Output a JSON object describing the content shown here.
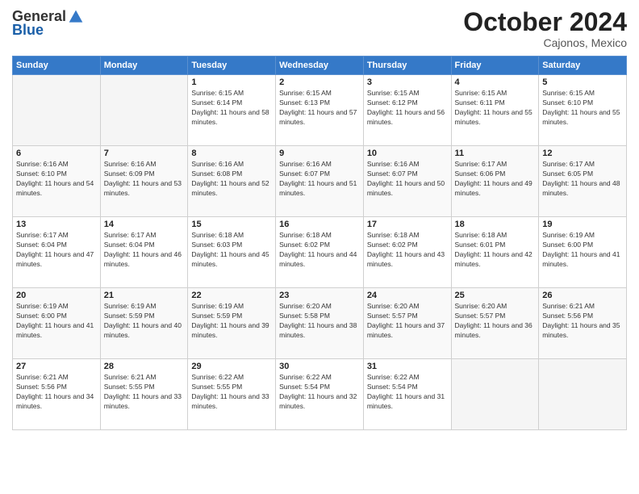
{
  "logo": {
    "general": "General",
    "blue": "Blue"
  },
  "header": {
    "month": "October 2024",
    "location": "Cajonos, Mexico"
  },
  "weekdays": [
    "Sunday",
    "Monday",
    "Tuesday",
    "Wednesday",
    "Thursday",
    "Friday",
    "Saturday"
  ],
  "weeks": [
    [
      {
        "day": "",
        "sunrise": "",
        "sunset": "",
        "daylight": ""
      },
      {
        "day": "",
        "sunrise": "",
        "sunset": "",
        "daylight": ""
      },
      {
        "day": "1",
        "sunrise": "Sunrise: 6:15 AM",
        "sunset": "Sunset: 6:14 PM",
        "daylight": "Daylight: 11 hours and 58 minutes."
      },
      {
        "day": "2",
        "sunrise": "Sunrise: 6:15 AM",
        "sunset": "Sunset: 6:13 PM",
        "daylight": "Daylight: 11 hours and 57 minutes."
      },
      {
        "day": "3",
        "sunrise": "Sunrise: 6:15 AM",
        "sunset": "Sunset: 6:12 PM",
        "daylight": "Daylight: 11 hours and 56 minutes."
      },
      {
        "day": "4",
        "sunrise": "Sunrise: 6:15 AM",
        "sunset": "Sunset: 6:11 PM",
        "daylight": "Daylight: 11 hours and 55 minutes."
      },
      {
        "day": "5",
        "sunrise": "Sunrise: 6:15 AM",
        "sunset": "Sunset: 6:10 PM",
        "daylight": "Daylight: 11 hours and 55 minutes."
      }
    ],
    [
      {
        "day": "6",
        "sunrise": "Sunrise: 6:16 AM",
        "sunset": "Sunset: 6:10 PM",
        "daylight": "Daylight: 11 hours and 54 minutes."
      },
      {
        "day": "7",
        "sunrise": "Sunrise: 6:16 AM",
        "sunset": "Sunset: 6:09 PM",
        "daylight": "Daylight: 11 hours and 53 minutes."
      },
      {
        "day": "8",
        "sunrise": "Sunrise: 6:16 AM",
        "sunset": "Sunset: 6:08 PM",
        "daylight": "Daylight: 11 hours and 52 minutes."
      },
      {
        "day": "9",
        "sunrise": "Sunrise: 6:16 AM",
        "sunset": "Sunset: 6:07 PM",
        "daylight": "Daylight: 11 hours and 51 minutes."
      },
      {
        "day": "10",
        "sunrise": "Sunrise: 6:16 AM",
        "sunset": "Sunset: 6:07 PM",
        "daylight": "Daylight: 11 hours and 50 minutes."
      },
      {
        "day": "11",
        "sunrise": "Sunrise: 6:17 AM",
        "sunset": "Sunset: 6:06 PM",
        "daylight": "Daylight: 11 hours and 49 minutes."
      },
      {
        "day": "12",
        "sunrise": "Sunrise: 6:17 AM",
        "sunset": "Sunset: 6:05 PM",
        "daylight": "Daylight: 11 hours and 48 minutes."
      }
    ],
    [
      {
        "day": "13",
        "sunrise": "Sunrise: 6:17 AM",
        "sunset": "Sunset: 6:04 PM",
        "daylight": "Daylight: 11 hours and 47 minutes."
      },
      {
        "day": "14",
        "sunrise": "Sunrise: 6:17 AM",
        "sunset": "Sunset: 6:04 PM",
        "daylight": "Daylight: 11 hours and 46 minutes."
      },
      {
        "day": "15",
        "sunrise": "Sunrise: 6:18 AM",
        "sunset": "Sunset: 6:03 PM",
        "daylight": "Daylight: 11 hours and 45 minutes."
      },
      {
        "day": "16",
        "sunrise": "Sunrise: 6:18 AM",
        "sunset": "Sunset: 6:02 PM",
        "daylight": "Daylight: 11 hours and 44 minutes."
      },
      {
        "day": "17",
        "sunrise": "Sunrise: 6:18 AM",
        "sunset": "Sunset: 6:02 PM",
        "daylight": "Daylight: 11 hours and 43 minutes."
      },
      {
        "day": "18",
        "sunrise": "Sunrise: 6:18 AM",
        "sunset": "Sunset: 6:01 PM",
        "daylight": "Daylight: 11 hours and 42 minutes."
      },
      {
        "day": "19",
        "sunrise": "Sunrise: 6:19 AM",
        "sunset": "Sunset: 6:00 PM",
        "daylight": "Daylight: 11 hours and 41 minutes."
      }
    ],
    [
      {
        "day": "20",
        "sunrise": "Sunrise: 6:19 AM",
        "sunset": "Sunset: 6:00 PM",
        "daylight": "Daylight: 11 hours and 41 minutes."
      },
      {
        "day": "21",
        "sunrise": "Sunrise: 6:19 AM",
        "sunset": "Sunset: 5:59 PM",
        "daylight": "Daylight: 11 hours and 40 minutes."
      },
      {
        "day": "22",
        "sunrise": "Sunrise: 6:19 AM",
        "sunset": "Sunset: 5:59 PM",
        "daylight": "Daylight: 11 hours and 39 minutes."
      },
      {
        "day": "23",
        "sunrise": "Sunrise: 6:20 AM",
        "sunset": "Sunset: 5:58 PM",
        "daylight": "Daylight: 11 hours and 38 minutes."
      },
      {
        "day": "24",
        "sunrise": "Sunrise: 6:20 AM",
        "sunset": "Sunset: 5:57 PM",
        "daylight": "Daylight: 11 hours and 37 minutes."
      },
      {
        "day": "25",
        "sunrise": "Sunrise: 6:20 AM",
        "sunset": "Sunset: 5:57 PM",
        "daylight": "Daylight: 11 hours and 36 minutes."
      },
      {
        "day": "26",
        "sunrise": "Sunrise: 6:21 AM",
        "sunset": "Sunset: 5:56 PM",
        "daylight": "Daylight: 11 hours and 35 minutes."
      }
    ],
    [
      {
        "day": "27",
        "sunrise": "Sunrise: 6:21 AM",
        "sunset": "Sunset: 5:56 PM",
        "daylight": "Daylight: 11 hours and 34 minutes."
      },
      {
        "day": "28",
        "sunrise": "Sunrise: 6:21 AM",
        "sunset": "Sunset: 5:55 PM",
        "daylight": "Daylight: 11 hours and 33 minutes."
      },
      {
        "day": "29",
        "sunrise": "Sunrise: 6:22 AM",
        "sunset": "Sunset: 5:55 PM",
        "daylight": "Daylight: 11 hours and 33 minutes."
      },
      {
        "day": "30",
        "sunrise": "Sunrise: 6:22 AM",
        "sunset": "Sunset: 5:54 PM",
        "daylight": "Daylight: 11 hours and 32 minutes."
      },
      {
        "day": "31",
        "sunrise": "Sunrise: 6:22 AM",
        "sunset": "Sunset: 5:54 PM",
        "daylight": "Daylight: 11 hours and 31 minutes."
      },
      {
        "day": "",
        "sunrise": "",
        "sunset": "",
        "daylight": ""
      },
      {
        "day": "",
        "sunrise": "",
        "sunset": "",
        "daylight": ""
      }
    ]
  ]
}
